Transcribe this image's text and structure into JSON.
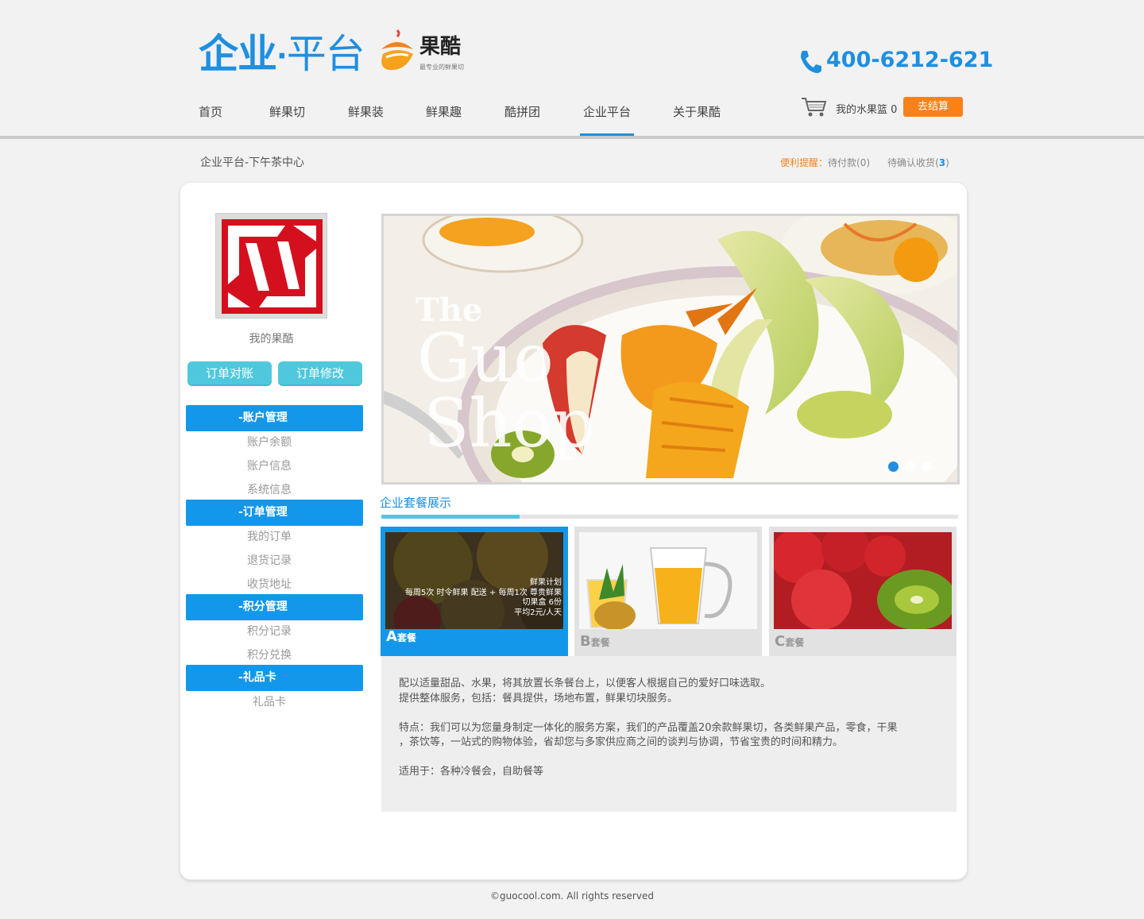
{
  "header": {
    "logo_main_a": "企业",
    "logo_main_dot": "·",
    "logo_main_b": "平台",
    "brand_name": "果酷",
    "brand_tagline": "最专业的鲜果切",
    "phone": "400-6212-621"
  },
  "nav": {
    "items": [
      {
        "label": "首页"
      },
      {
        "label": "鲜果切"
      },
      {
        "label": "鲜果装"
      },
      {
        "label": "鲜果趣"
      },
      {
        "label": "酷拼团"
      },
      {
        "label": "企业平台"
      },
      {
        "label": "关于果酷"
      }
    ],
    "active_index": 5
  },
  "cart": {
    "label": "我的水果篮",
    "count": "0",
    "checkout_label": "去结算"
  },
  "breadcrumb": "企业平台-下午茶中心",
  "reminder": {
    "label": "便利提醒：",
    "pending_pay": "待付款",
    "pending_pay_count": "0",
    "pending_receive": "待确认收货",
    "pending_receive_count": "3"
  },
  "sidebar": {
    "my_label": "我的果酷",
    "btn_reconcile": "订单对账",
    "btn_modify": "订单修改",
    "groups": [
      {
        "head": "-账户管理",
        "items": [
          "账户余额",
          "账户信息",
          "系统信息"
        ]
      },
      {
        "head": "-订单管理",
        "items": [
          "我的订单",
          "退货记录",
          "收货地址"
        ]
      },
      {
        "head": "-积分管理",
        "items": [
          "积分记录",
          "积分兑换"
        ]
      },
      {
        "head": "-礼品卡",
        "items": [
          "礼品卡"
        ]
      }
    ]
  },
  "banner": {
    "text_the": "The",
    "text_guo": "Guo",
    "text_shop": "Shop",
    "slide_count": 3,
    "active_slide": 0
  },
  "section": {
    "title": "企业套餐展示"
  },
  "packages": [
    {
      "letter": "A",
      "suffix": "套餐",
      "overlay": [
        "鲜果计划",
        "每周5次 时令鲜果 配送 + 每周1次 尊贵鲜果",
        "切果盒 6份",
        "平均2元/人天"
      ]
    },
    {
      "letter": "B",
      "suffix": "套餐"
    },
    {
      "letter": "C",
      "suffix": "套餐"
    }
  ],
  "description": {
    "lines": [
      "配以适量甜品、水果，将其放置长条餐台上，以便客人根据自己的爱好口味选取。",
      "提供整体服务，包括：餐具提供，场地布置，鲜果切块服务。",
      "",
      "特点：我们可以为您量身制定一体化的服务方案，我们的产品覆盖20余款鲜果切，各类鲜果产品，零食，干果",
      "，茶饮等，一站式的购物体验，省却您与多家供应商之间的谈判与协调，节省宝贵的时间和精力。",
      "",
      "适用于：各种冷餐会，自助餐等"
    ]
  },
  "footer": "©guocool.com. All rights reserved",
  "colors": {
    "primary_blue": "#1e8fe1",
    "menu_blue": "#1397ea",
    "teal": "#4fc8dd",
    "orange": "#f7821c"
  },
  "icons": [
    "phone-icon",
    "cart-icon"
  ]
}
